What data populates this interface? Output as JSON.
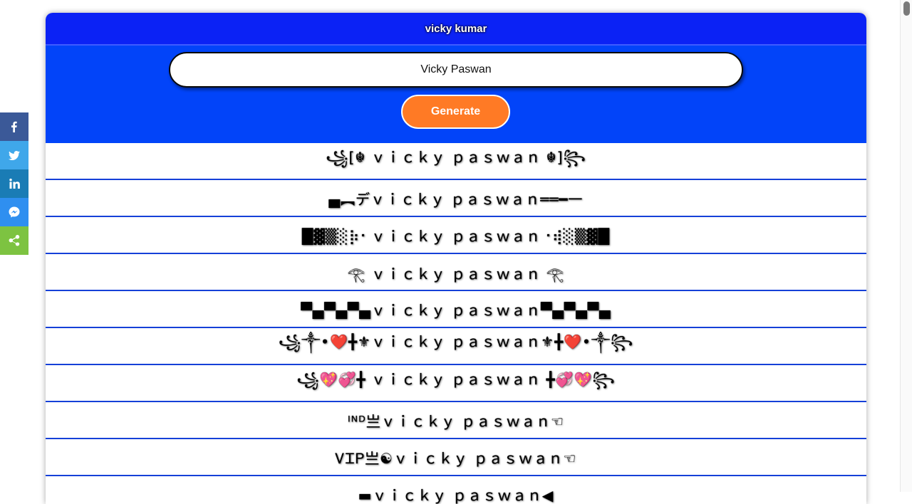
{
  "header": {
    "title": "vicky kumar"
  },
  "form": {
    "input_value": "Vicky Paswan",
    "button_label": "Generate"
  },
  "results": [
    "꧁[☬ ｖｉｃｋｙ ｐａｓｗａｎ ☬]꧂",
    "▄︻デｖｉｃｋｙ ｐａｓｗａｎ══━一",
    "█▓▒░⡷⠂ｖｉｃｋｙ ｐａｓｗａｎ⠐⢾░▒▓█",
    "𓂀 ｖｉｃｋｙ ｐａｓｗａｎ 𓂀",
    "▀▄▀▄▀▄ｖｉｃｋｙ ｐａｓｗａｎ▀▄▀▄▀▄",
    "꧁༒•❤️╋⚜ｖｉｃｋｙ ｐａｓｗａｎ⚜╋❤️•༒꧂",
    "꧁💖💞╋ ｖｉｃｋｙ ｐａｓｗａｎ ╋💞💖꧂",
    "ᴵᴺᴰ亗ｖｉｃｋｙ ｐａｓｗａｎ☜",
    "ᏙᏆᏢ亗☯ｖｉｃｋｙ ｐａｓｗａｎ☜",
    "▬ｖｉｃｋｙ ｐａｓｗａｎ◀"
  ],
  "share": [
    {
      "name": "facebook-icon",
      "color": "#3b5998"
    },
    {
      "name": "twitter-icon",
      "color": "#1da1f2"
    },
    {
      "name": "linkedin-icon",
      "color": "#0077b5"
    },
    {
      "name": "messenger-icon",
      "color": "#2196f3"
    },
    {
      "name": "share-icon",
      "color": "#7dc341"
    }
  ],
  "colors": {
    "header": "#0b22f5",
    "hero": "#0244f9",
    "button": "#ff7a25",
    "divider": "#1540d8"
  }
}
